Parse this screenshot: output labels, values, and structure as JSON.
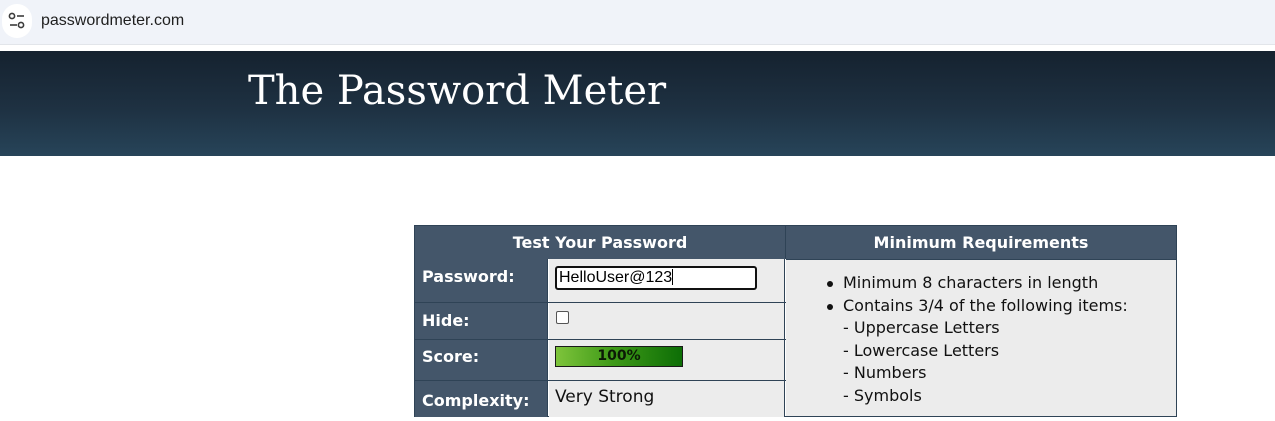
{
  "browser": {
    "url": "passwordmeter.com",
    "site_info_icon": "tune-icon"
  },
  "banner": {
    "title": "The Password Meter"
  },
  "meter": {
    "header_left": "Test Your Password",
    "header_right": "Minimum Requirements",
    "password_label": "Password:",
    "password_value": "HelloUser@123",
    "hide_label": "Hide:",
    "hide_checked": false,
    "score_label": "Score:",
    "score_value": "100%",
    "score_fraction": 1.0,
    "complexity_label": "Complexity:",
    "complexity_value": "Very Strong"
  },
  "requirements": {
    "items": [
      "Minimum 8 characters in length",
      "Contains 3/4 of the following items:"
    ],
    "subitems": [
      "- Uppercase Letters",
      "- Lowercase Letters",
      "- Numbers",
      "- Symbols"
    ]
  },
  "colors": {
    "banner": "#1e3142",
    "table_header": "#44566a",
    "cell_bg": "#ececec",
    "score_green": "#3f9a18"
  }
}
